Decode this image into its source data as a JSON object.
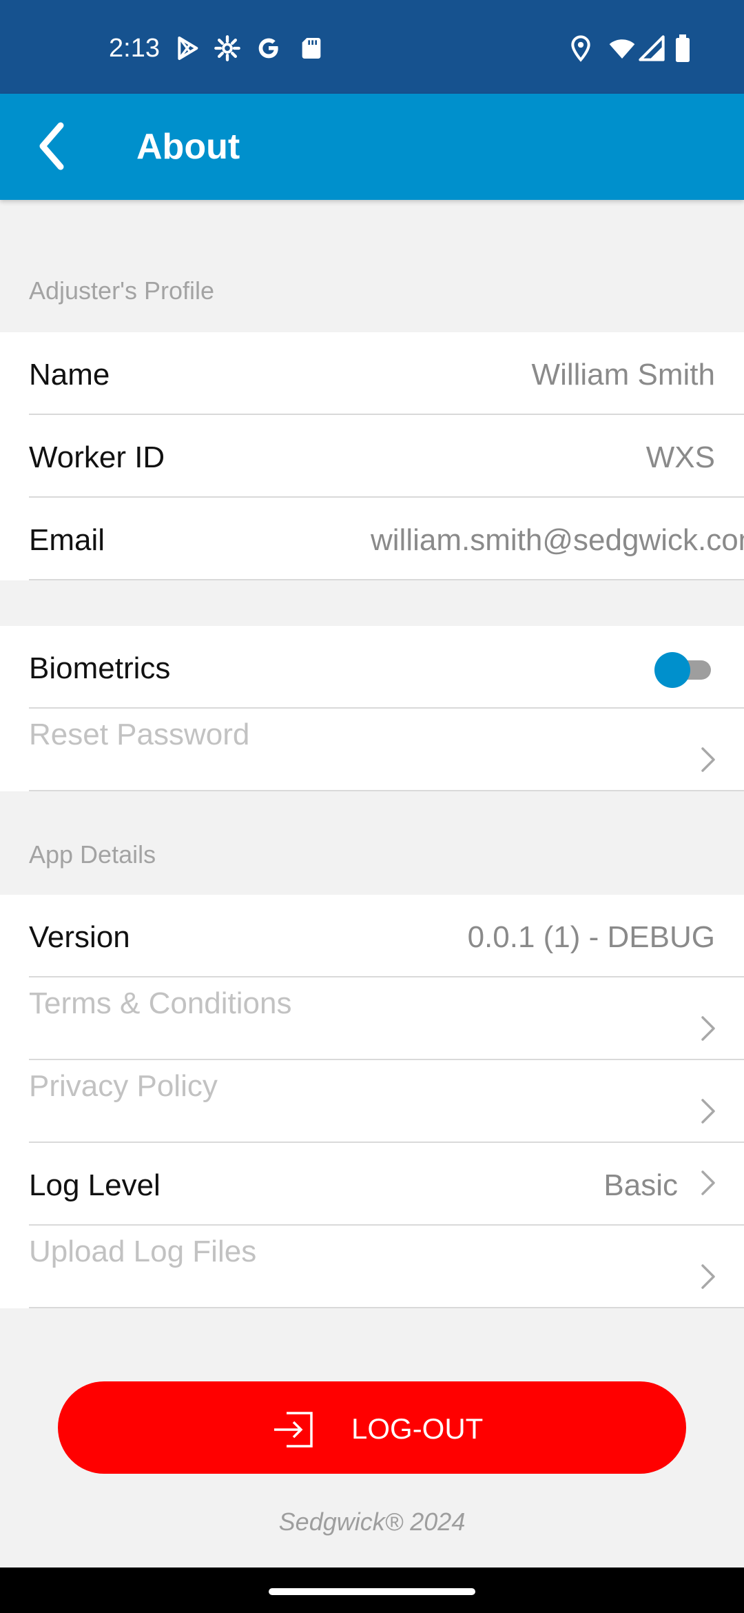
{
  "status_bar": {
    "time": "2:13",
    "left_icons": [
      "play-store-icon",
      "gear-icon",
      "google-icon",
      "sd-card-icon"
    ],
    "right_icons": [
      "location-icon",
      "wifi-icon",
      "signal-icon",
      "battery-icon"
    ]
  },
  "app_bar": {
    "back_icon": "chevron-left-icon",
    "title": "About"
  },
  "profile_section": {
    "header": "Adjuster's Profile",
    "rows": [
      {
        "label": "Name",
        "value": "William Smith"
      },
      {
        "label": "Worker ID",
        "value": "WXS"
      },
      {
        "label": "Email",
        "value": "william.smith@sedgwick.com"
      }
    ]
  },
  "security_section": {
    "biometrics_label": "Biometrics",
    "biometrics_enabled": false,
    "reset_password_label": "Reset Password"
  },
  "app_details_section": {
    "header": "App Details",
    "version_label": "Version",
    "version_value": "0.0.1 (1) - DEBUG",
    "terms_label": "Terms & Conditions",
    "privacy_label": "Privacy Policy",
    "log_level_label": "Log Level",
    "log_level_value": "Basic",
    "upload_logs_label": "Upload Log Files"
  },
  "logout_button": {
    "icon": "log-in-icon",
    "label": "LOG-OUT"
  },
  "footer": {
    "text": "Sedgwick® 2024"
  },
  "colors": {
    "status_bar": "#16528f",
    "app_bar": "#0090cc",
    "accent": "#0090cc",
    "logout": "#ff0000",
    "background": "#f2f2f2"
  }
}
